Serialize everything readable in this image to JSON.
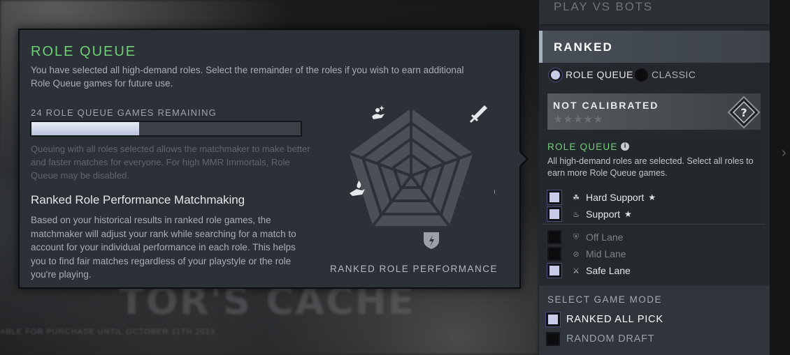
{
  "background": {
    "title_text": "TOR'S CACHE",
    "subtitle_text": "ABLE FOR PURCHASE UNTIL OCTOBER 11TH 2023"
  },
  "tooltip": {
    "title": "ROLE QUEUE",
    "description": "You have selected all high-demand roles.  Select the remainder of the roles if you wish to earn additional Role Queue games for future use.",
    "games_remaining_label": "24 ROLE QUEUE GAMES REMAINING",
    "progress_fraction": 0.4,
    "note": "Queuing with all roles selected allows the matchmaker to make better and faster matches for everyone. For high MMR Immortals, Role Queue may be disabled.",
    "subheading": "Ranked Role Performance Matchmaking",
    "body": "Based on your historical results in ranked role games, the matchmaker will adjust your rank while searching for a match to account for your individual performance in each role. This helps you to find fair matches regardless of your playstyle or the role you're playing.",
    "radar_label": "RANKED ROLE PERFORMANCE",
    "radar_icons": [
      "support-icon",
      "sword-icon",
      "bow-icon",
      "shield-icon",
      "hard-support-icon"
    ]
  },
  "sidebar": {
    "play_vs_bots": "PLAY VS BOTS",
    "ranked": "RANKED",
    "modes": [
      {
        "label": "ROLE QUEUE",
        "selected": true
      },
      {
        "label": "CLASSIC",
        "selected": false
      }
    ],
    "calibration": {
      "label": "NOT CALIBRATED",
      "stars": "★★★★★",
      "badge_icon": "question-badge-icon"
    },
    "role_queue": {
      "title": "ROLE QUEUE",
      "info_icon": "i",
      "description": "All high-demand roles are selected.  Select all roles to earn more Role Queue games.",
      "roles": [
        {
          "label": "Hard Support",
          "icon": "hard-support-icon",
          "checked": true,
          "high_demand": true
        },
        {
          "label": "Support",
          "icon": "support-icon",
          "checked": true,
          "high_demand": true
        },
        {
          "label": "Off Lane",
          "icon": "shield-icon",
          "checked": false,
          "high_demand": false
        },
        {
          "label": "Mid Lane",
          "icon": "bow-icon",
          "checked": false,
          "high_demand": false
        },
        {
          "label": "Safe Lane",
          "icon": "sword-icon",
          "checked": true,
          "high_demand": false
        }
      ]
    },
    "game_mode": {
      "title": "SELECT GAME MODE",
      "options": [
        {
          "label": "RANKED ALL PICK",
          "checked": true
        },
        {
          "label": "RANDOM DRAFT",
          "checked": false
        }
      ]
    }
  },
  "colors": {
    "accent_green": "#6fcf76",
    "panel": "#2b3136",
    "check_on": "#c8cee9"
  }
}
